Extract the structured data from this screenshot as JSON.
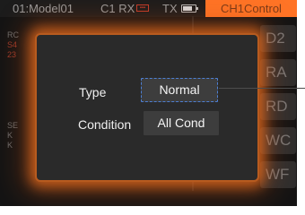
{
  "status_bar": {
    "model": "01:Model01",
    "receiver": "C1 RX",
    "receiver_icon": "rx-signal-icon",
    "transmitter": "TX",
    "battery_icon": "battery-icon",
    "channel": "CH1Control"
  },
  "background": {
    "buttons": [
      "D2",
      "RA",
      "RD",
      "WC",
      "WF"
    ]
  },
  "dialog": {
    "type_label": "Type",
    "type_value": "Normal",
    "condition_label": "Condition",
    "condition_value": "All Cond"
  },
  "colors": {
    "accent": "#ff7426",
    "glow": "#e8691f",
    "selection_border": "#4d7fd3",
    "dialog_bg": "#2a2a2a",
    "screen_bg": "#141414"
  }
}
